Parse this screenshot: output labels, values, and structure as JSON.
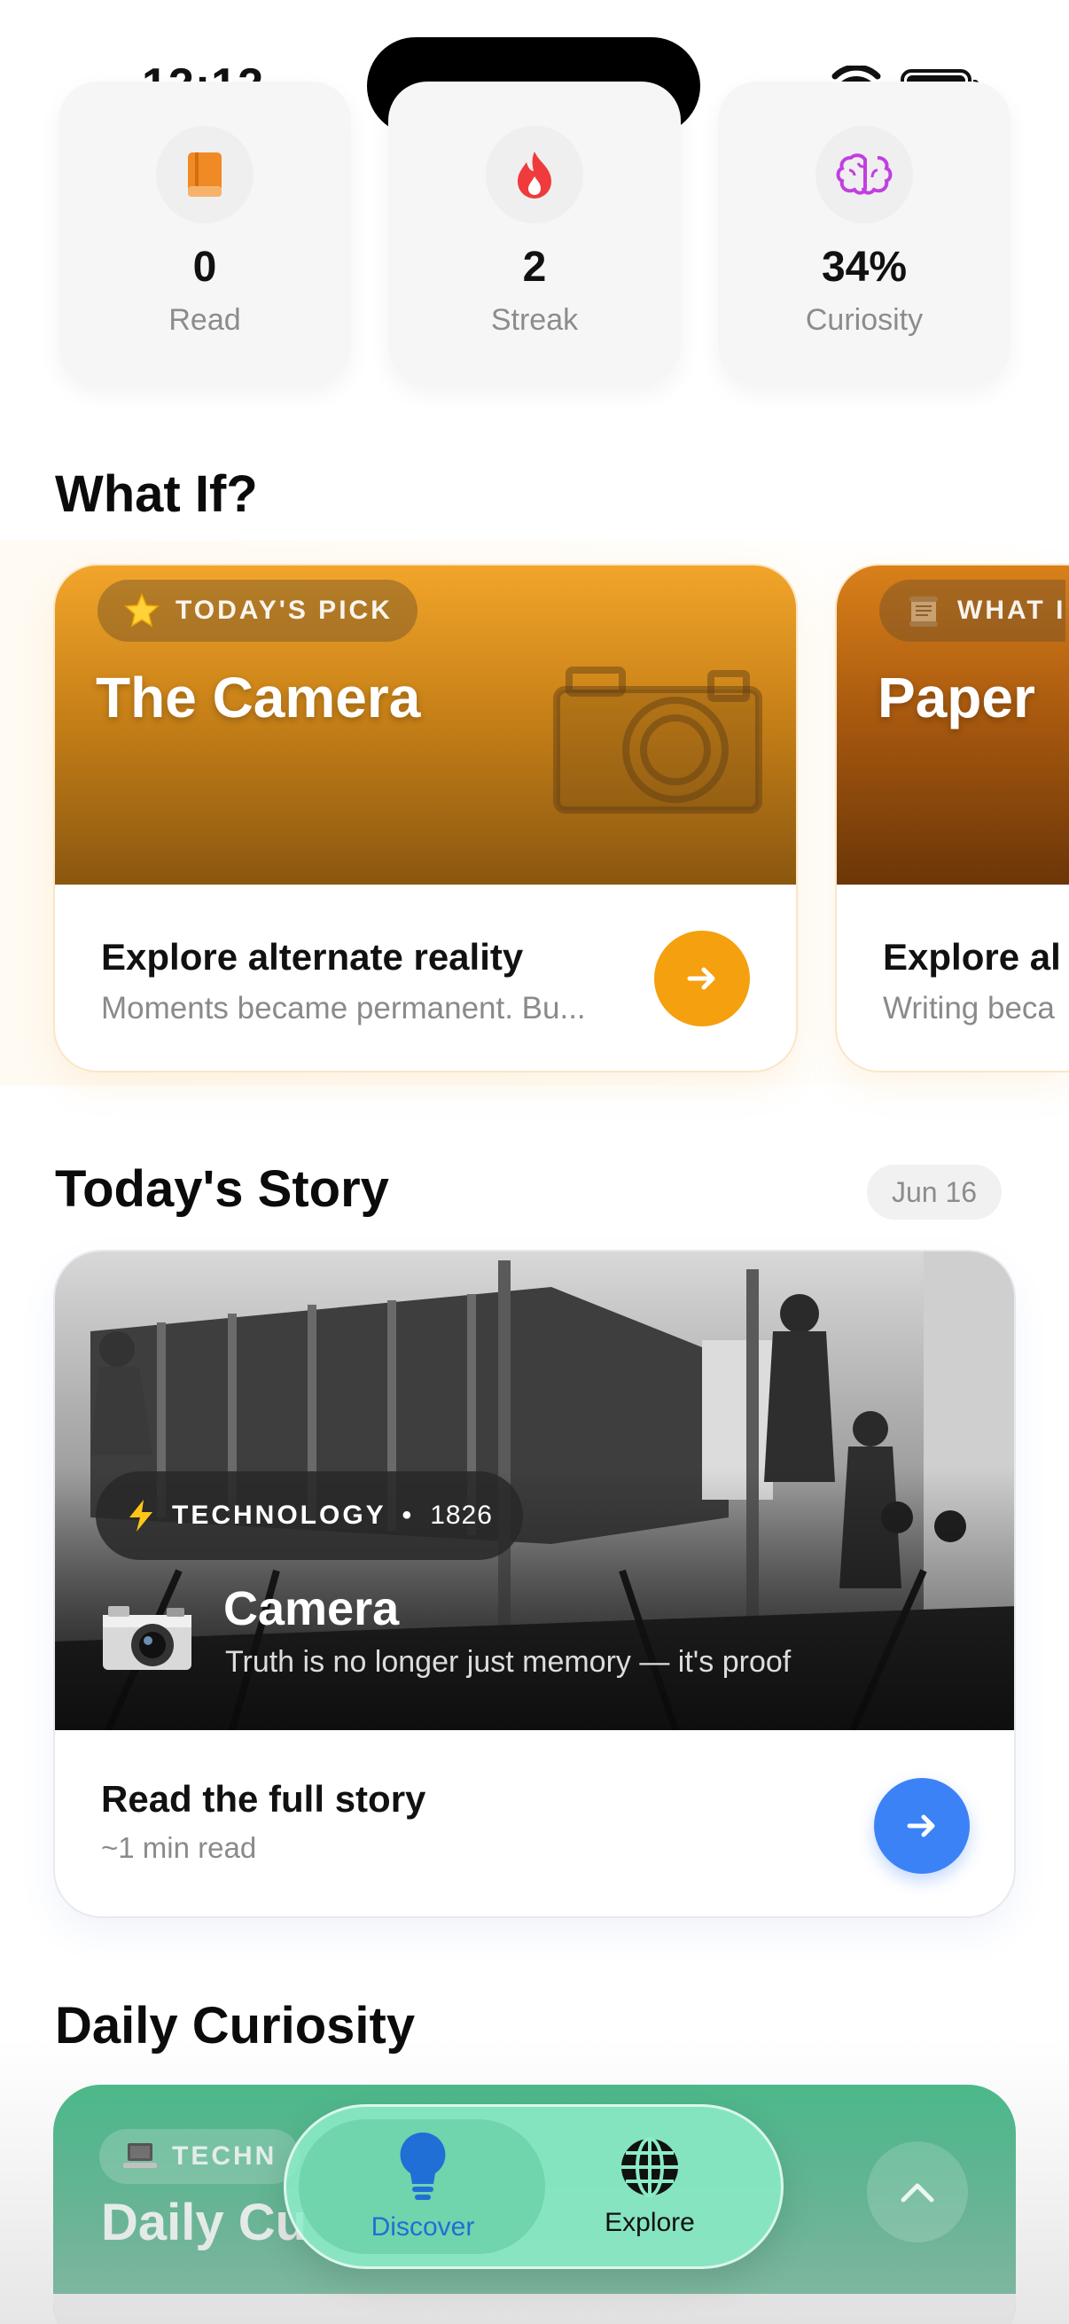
{
  "status_bar": {
    "time": "12:12"
  },
  "stats": [
    {
      "icon": "book-icon",
      "value": "0",
      "label": "Read"
    },
    {
      "icon": "flame-icon",
      "value": "2",
      "label": "Streak"
    },
    {
      "icon": "brain-icon",
      "value": "34%",
      "label": "Curiosity"
    }
  ],
  "what_if": {
    "title": "What If?",
    "cards": [
      {
        "badge": "TODAY'S PICK",
        "title": "The Camera",
        "subtitle": "Explore alternate reality",
        "description": "Moments became permanent. Bu..."
      },
      {
        "badge": "WHAT I",
        "title": "Paper",
        "subtitle": "Explore al",
        "description": "Writing beca"
      }
    ]
  },
  "todays_story": {
    "title": "Today's Story",
    "date": "Jun 16",
    "category": "TECHNOLOGY",
    "year_sep": "•",
    "year": "1826",
    "story_title": "Camera",
    "tagline": "Truth is no longer just memory — it's proof",
    "cta": "Read the full story",
    "read_time": "~1 min read"
  },
  "daily_curiosity": {
    "title": "Daily Curiosity",
    "badge": "TECHN",
    "card_title": "Daily Cu"
  },
  "tabbar": {
    "tabs": [
      {
        "label": "Discover",
        "icon": "lightbulb-icon",
        "active": true
      },
      {
        "label": "Explore",
        "icon": "globe-icon",
        "active": false
      }
    ]
  },
  "colors": {
    "accent_orange": "#f5a00f",
    "accent_blue": "#3b82f6",
    "accent_green": "#34a877",
    "active_tab": "#1f6fd6"
  }
}
